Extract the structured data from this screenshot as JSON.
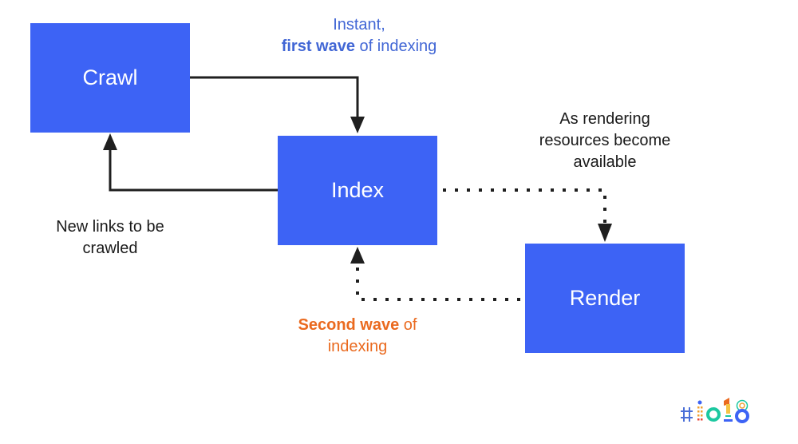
{
  "nodes": {
    "crawl": "Crawl",
    "index": "Index",
    "render": "Render"
  },
  "labels": {
    "first_wave": {
      "line1": "Instant,",
      "bold": "first wave",
      "rest": " of indexing"
    },
    "rendering_resources": {
      "line1": "As rendering",
      "line2": "resources become",
      "line3": "available"
    },
    "new_links": {
      "line1": "New links to be",
      "line2": "crawled"
    },
    "second_wave": {
      "bold": "Second wave",
      "rest": " of",
      "line2": "indexing"
    }
  },
  "colors": {
    "box": "#3d63f5",
    "first_wave_text": "#4166d5",
    "second_wave_text": "#ea6a1f"
  },
  "logo": {
    "text": "#io18"
  }
}
